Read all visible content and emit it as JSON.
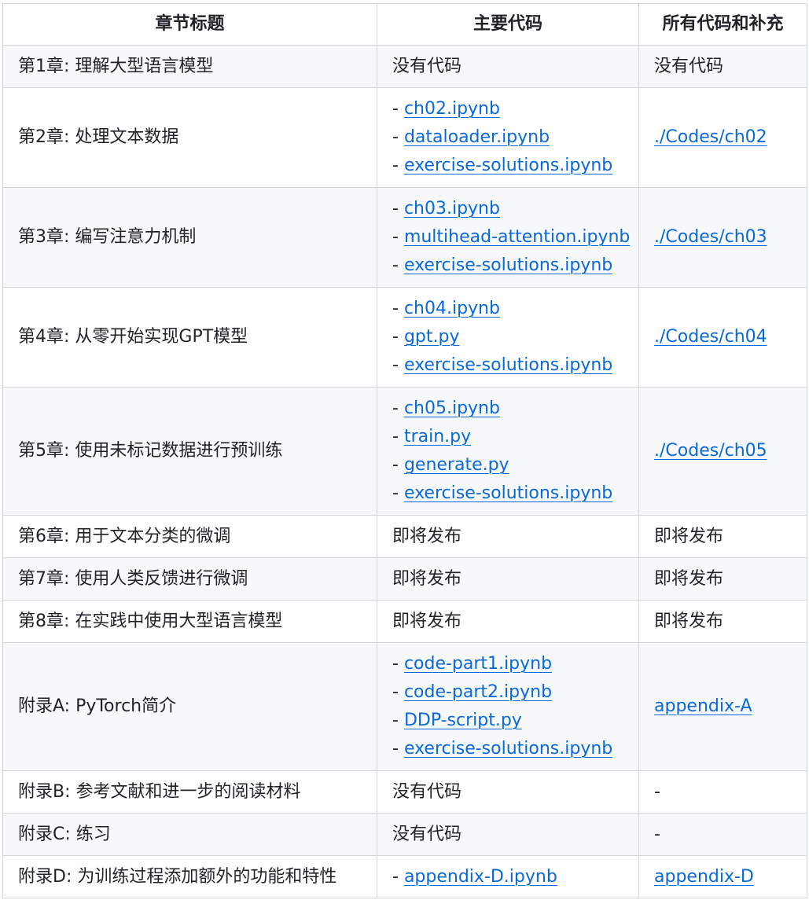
{
  "headers": [
    "章节标题",
    "主要代码",
    "所有代码和补充"
  ],
  "rows": [
    {
      "title": "第1章: 理解大型语言模型",
      "main_text": "没有代码",
      "main_files": [],
      "extra": "没有代码",
      "extra_is_link": false
    },
    {
      "title": "第2章: 处理文本数据",
      "main_text": "",
      "main_files": [
        "ch02.ipynb",
        "dataloader.ipynb",
        "exercise-solutions.ipynb"
      ],
      "extra": "./Codes/ch02",
      "extra_is_link": true
    },
    {
      "title": "第3章: 编写注意力机制",
      "main_text": "",
      "main_files": [
        "ch03.ipynb",
        "multihead-attention.ipynb",
        "exercise-solutions.ipynb"
      ],
      "extra": "./Codes/ch03",
      "extra_is_link": true
    },
    {
      "title": "第4章: 从零开始实现GPT模型",
      "main_text": "",
      "main_files": [
        "ch04.ipynb",
        "gpt.py",
        "exercise-solutions.ipynb"
      ],
      "extra": "./Codes/ch04",
      "extra_is_link": true
    },
    {
      "title": "第5章: 使用未标记数据进行预训练",
      "main_text": "",
      "main_files": [
        "ch05.ipynb",
        "train.py",
        "generate.py",
        "exercise-solutions.ipynb"
      ],
      "extra": "./Codes/ch05",
      "extra_is_link": true
    },
    {
      "title": "第6章: 用于文本分类的微调",
      "main_text": "即将发布",
      "main_files": [],
      "extra": "即将发布",
      "extra_is_link": false
    },
    {
      "title": "第7章: 使用人类反馈进行微调",
      "main_text": "即将发布",
      "main_files": [],
      "extra": "即将发布",
      "extra_is_link": false
    },
    {
      "title": "第8章: 在实践中使用大型语言模型",
      "main_text": "即将发布",
      "main_files": [],
      "extra": "即将发布",
      "extra_is_link": false
    },
    {
      "title": "附录A: PyTorch简介",
      "main_text": "",
      "main_files": [
        "code-part1.ipynb",
        "code-part2.ipynb",
        "DDP-script.py",
        "exercise-solutions.ipynb"
      ],
      "extra": "appendix-A",
      "extra_is_link": true
    },
    {
      "title": "附录B: 参考文献和进一步的阅读材料",
      "main_text": "没有代码",
      "main_files": [],
      "extra": "-",
      "extra_is_link": false
    },
    {
      "title": "附录C: 练习",
      "main_text": "没有代码",
      "main_files": [],
      "extra": "-",
      "extra_is_link": false
    },
    {
      "title": "附录D: 为训练过程添加额外的功能和特性",
      "main_text": "",
      "main_files": [
        "appendix-D.ipynb"
      ],
      "extra": "appendix-D",
      "extra_is_link": true
    }
  ],
  "file_prefix": "- ",
  "colors": {
    "link": "#0969da",
    "text": "#1f2328",
    "border": "#d0d7de",
    "stripe": "#f6f8fa"
  }
}
